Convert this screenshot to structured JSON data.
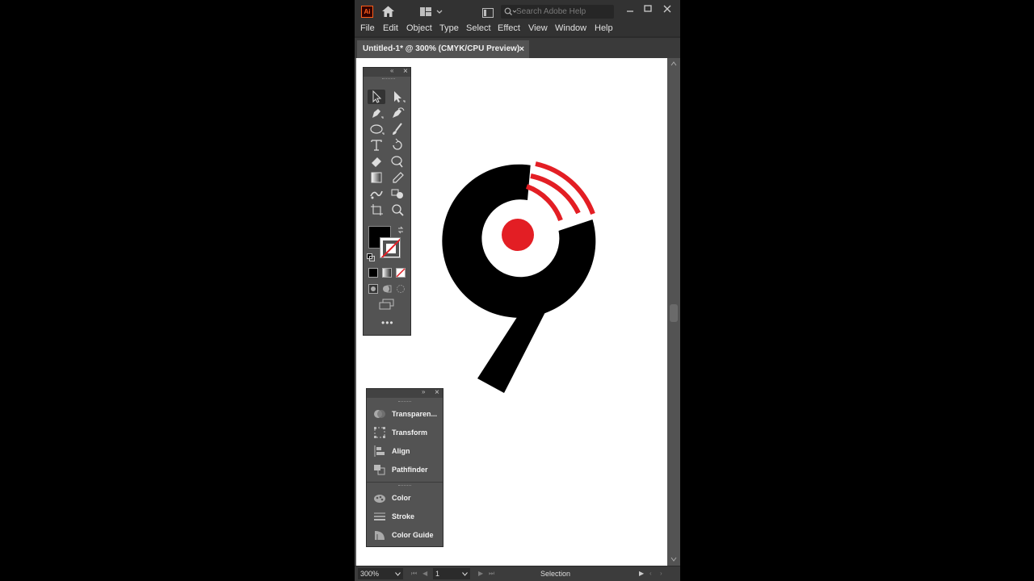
{
  "app": {
    "logo_text": "Ai",
    "search_placeholder": "Search Adobe Help"
  },
  "menu": [
    "File",
    "Edit",
    "Object",
    "Type",
    "Select",
    "Effect",
    "View",
    "Window",
    "Help"
  ],
  "document_tab": {
    "title": "Untitled-1* @ 300% (CMYK/CPU Preview)",
    "close": "×"
  },
  "statusbar": {
    "zoom": "300%",
    "artboard": "1",
    "tool_status": "Selection"
  },
  "panel": {
    "items_top": [
      {
        "label": "Transparen...",
        "icon": "transparency-icon"
      },
      {
        "label": "Transform",
        "icon": "transform-icon"
      },
      {
        "label": "Align",
        "icon": "align-icon"
      },
      {
        "label": "Pathfinder",
        "icon": "pathfinder-icon"
      }
    ],
    "items_bottom": [
      {
        "label": "Color",
        "icon": "color-icon"
      },
      {
        "label": "Stroke",
        "icon": "stroke-icon"
      },
      {
        "label": "Color Guide",
        "icon": "color-guide-icon"
      }
    ]
  },
  "artwork": {
    "fill_color": "#000000",
    "accent_color": "#e31e24"
  }
}
